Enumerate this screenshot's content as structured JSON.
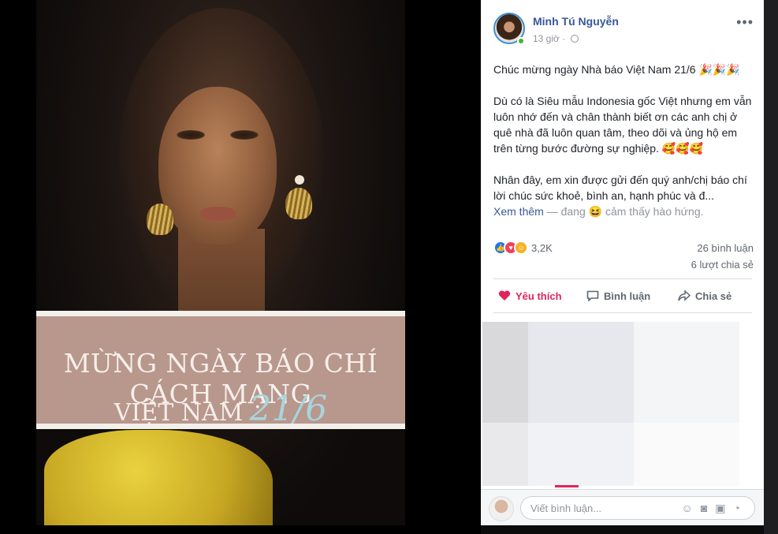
{
  "post": {
    "author": "Minh Tú Nguyễn",
    "time": "13 giờ",
    "more": "•••",
    "paragraphs": [
      "Chúc mừng ngày Nhà báo Việt Nam 21/6 🎉🎉🎉",
      "Dù có là Siêu mẫu Indonesia gốc Việt nhưng em vẫn luôn nhớ đến và chân thành biết ơn các anh chị ở quê nhà đã luôn quan tâm, theo dõi và ủng hộ em trên từng bước đường sự nghiệp. 🥰🥰🥰",
      "Nhân đây, em xin được gửi đến quý anh/chị báo chí lời chúc sức khoẻ, bình an, hạnh phúc và đ..."
    ],
    "see_more": "Xem thêm",
    "feeling": " — đang 😆 cảm thấy hào hứng."
  },
  "stats": {
    "reactions": "3,2K",
    "comments": "26 bình luận",
    "shares": "6 lượt chia sẻ"
  },
  "actions": {
    "like": "Yêu thích",
    "comment": "Bình luận",
    "share": "Chia sẻ"
  },
  "comment_box": {
    "placeholder": "Viết bình luận..."
  },
  "photo": {
    "banner_line1": "MỪNG NGÀY BÁO CHÍ CÁCH MẠNG",
    "banner_line2": "VIỆT NAM",
    "banner_number": "21/6"
  },
  "colors": {
    "link": "#385898",
    "love": "#e0245e",
    "banner": "#b8978d"
  }
}
